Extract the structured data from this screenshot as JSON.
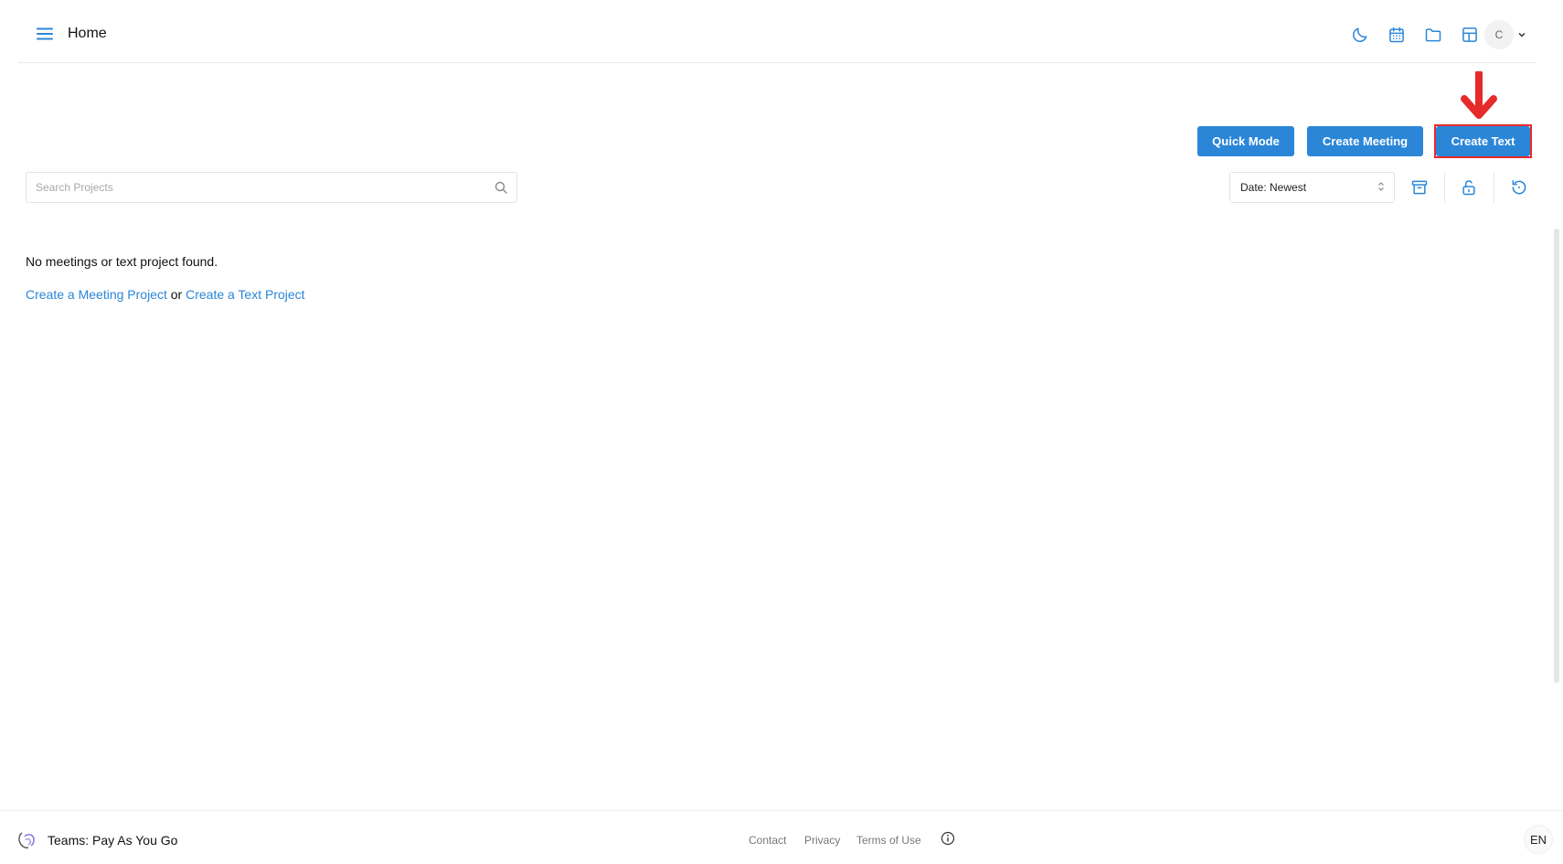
{
  "header": {
    "title": "Home",
    "avatar_initial": "C",
    "icons": [
      "menu-icon",
      "moon-icon",
      "calendar-icon",
      "folder-icon",
      "layout-icon",
      "chevron-down-icon"
    ]
  },
  "actions": {
    "quick_mode": "Quick Mode",
    "create_meeting": "Create Meeting",
    "create_text": "Create Text"
  },
  "search": {
    "placeholder": "Search Projects",
    "value": ""
  },
  "sort": {
    "selected": "Date: Newest"
  },
  "empty_state": {
    "message": "No meetings or text project found.",
    "link_meeting": "Create a Meeting Project",
    "connector": "or",
    "link_text": "Create a Text Project"
  },
  "footer": {
    "team": "Teams: Pay As You Go",
    "contact": "Contact",
    "privacy": "Privacy",
    "terms": "Terms of Use",
    "language": "EN"
  },
  "colors": {
    "accent": "#2b86d8",
    "highlight": "#e52a2a"
  }
}
